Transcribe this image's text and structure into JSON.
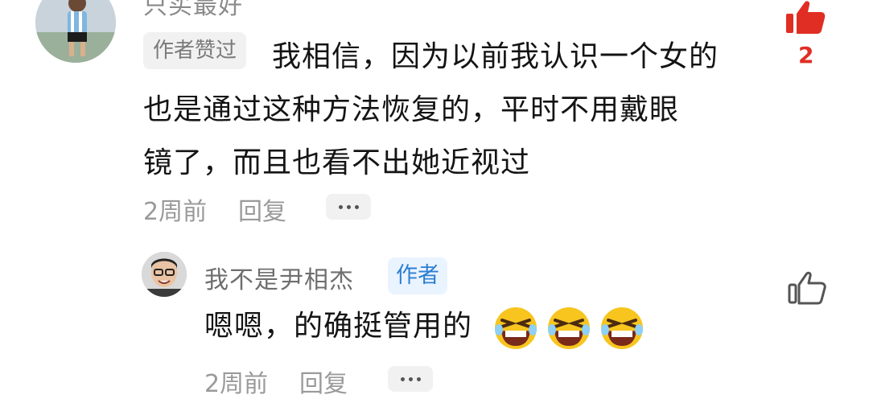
{
  "comment": {
    "username": "只买最好",
    "badge": "作者赞过",
    "text_line1": "我相信，因为以前我认识一个女的",
    "text_line2": "也是通过这种方法恢复的，平时不用戴眼",
    "text_line3": "镜了，而且也看不出她近视过",
    "time": "2周前",
    "reply_label": "回复",
    "like_count": "2",
    "like_color": "#e02e24"
  },
  "reply": {
    "username": "我不是尹相杰",
    "badge": "作者",
    "text": "嗯嗯，的确挺管用的",
    "emoji": [
      "laughing-emoji",
      "laughing-emoji",
      "laughing-emoji"
    ],
    "time": "2周前",
    "reply_label": "回复"
  }
}
